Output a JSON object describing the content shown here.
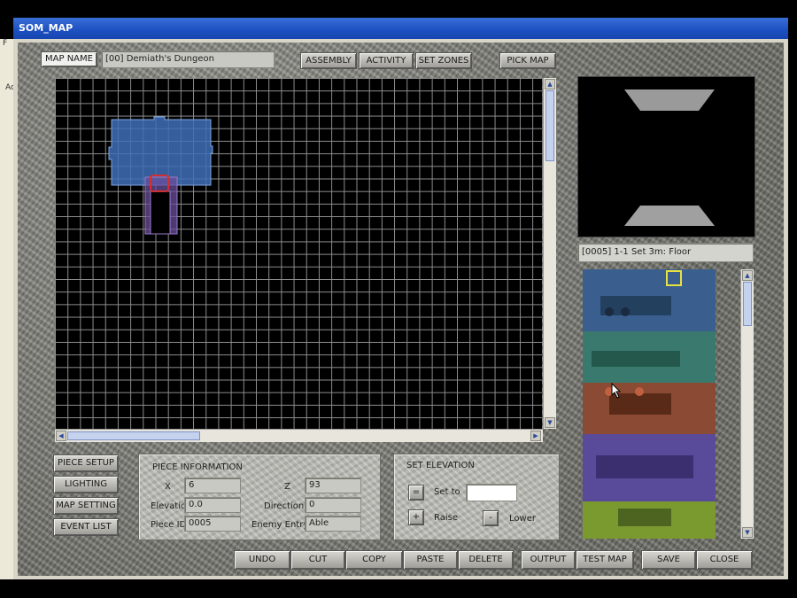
{
  "window": {
    "title": "SOM_MAP"
  },
  "map": {
    "name_label": "MAP NAME",
    "name_value": "[00] Demiath's Dungeon"
  },
  "top_buttons": {
    "assembly": "ASSEMBLY",
    "activity": "ACTIVITY",
    "set_zones": "SET ZONES",
    "pick_map": "PICK MAP"
  },
  "left_buttons": {
    "piece_setup": "PIECE SETUP",
    "lighting": "LIGHTING",
    "map_setting": "MAP SETTING",
    "event_list": "EVENT LIST"
  },
  "piece_info": {
    "title": "PIECE INFORMATION",
    "x_label": "X",
    "x_value": "6",
    "z_label": "Z",
    "z_value": "93",
    "elevation_label": "Elevation",
    "elevation_value": "0.0",
    "direction_label": "Direction",
    "direction_value": "0",
    "piece_id_label": "Piece ID",
    "piece_id_value": "0005",
    "enemy_entry_label": "Enemy Entry",
    "enemy_entry_value": "Able"
  },
  "set_elevation": {
    "title": "SET ELEVATION",
    "set_symbol": "=",
    "set_label": "Set to",
    "set_value": "",
    "raise_symbol": "+",
    "raise_label": "Raise",
    "lower_symbol": "-",
    "lower_label": "Lower"
  },
  "piece_selected": {
    "label": "[0005] 1-1 Set 3m: Floor"
  },
  "bottom_buttons": {
    "undo": "UNDO",
    "cut": "CUT",
    "copy": "COPY",
    "paste": "PASTE",
    "delete": "DELETE",
    "output": "OUTPUT",
    "test_map": "TEST MAP",
    "save": "SAVE",
    "close": "CLOSE"
  },
  "behind_window": {
    "glyph_top": "F",
    "glyph_mid": "Ac"
  },
  "colors": {
    "title_bar": "#1c4fc0",
    "room_fill": "#3f6fb8",
    "corridor_fill": "#6a4e9a",
    "selected_outline": "#d03030",
    "palette_blue": "#3a5f8f",
    "palette_teal": "#3a7a6e",
    "palette_brown": "#8a4a34",
    "palette_purple": "#5a4a9a",
    "palette_olive": "#7a9a30"
  },
  "icons": {
    "scroll_up": "arrow-up-icon",
    "scroll_down": "arrow-down-icon",
    "scroll_left": "arrow-left-icon",
    "scroll_right": "arrow-right-icon"
  }
}
